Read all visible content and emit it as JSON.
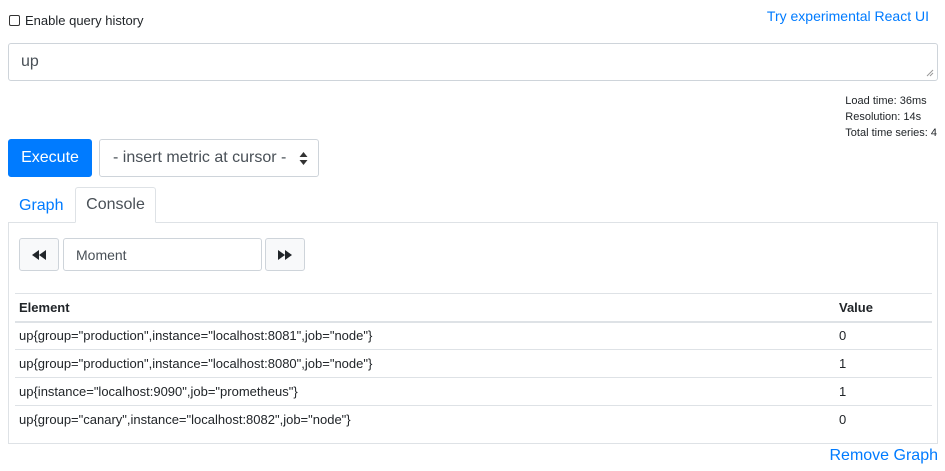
{
  "query_history": {
    "label": "Enable query history",
    "checked": false
  },
  "react_ui_link": "Try experimental React UI",
  "expression": {
    "value": "up"
  },
  "stats": {
    "load_time": "Load time: 36ms",
    "resolution": "Resolution: 14s",
    "total_series": "Total time series: 4"
  },
  "execute_label": "Execute",
  "metric_select": {
    "selected": "- insert metric at cursor -"
  },
  "tabs": {
    "graph": "Graph",
    "console": "Console",
    "active": "Console"
  },
  "console": {
    "moment_placeholder": "Moment",
    "table": {
      "headers": {
        "element": "Element",
        "value": "Value"
      },
      "rows": [
        {
          "element": "up{group=\"production\",instance=\"localhost:8081\",job=\"node\"}",
          "value": "0"
        },
        {
          "element": "up{group=\"production\",instance=\"localhost:8080\",job=\"node\"}",
          "value": "1"
        },
        {
          "element": "up{instance=\"localhost:9090\",job=\"prometheus\"}",
          "value": "1"
        },
        {
          "element": "up{group=\"canary\",instance=\"localhost:8082\",job=\"node\"}",
          "value": "0"
        }
      ]
    }
  },
  "remove_graph_label": "Remove Graph",
  "colors": {
    "primary": "#007bff",
    "border": "#dee2e6",
    "text": "#212529"
  },
  "icons": {
    "back": "fast-backward-icon",
    "forward": "fast-forward-icon",
    "select_arrows": "select-arrows-icon",
    "resize": "resize-grip-icon"
  }
}
